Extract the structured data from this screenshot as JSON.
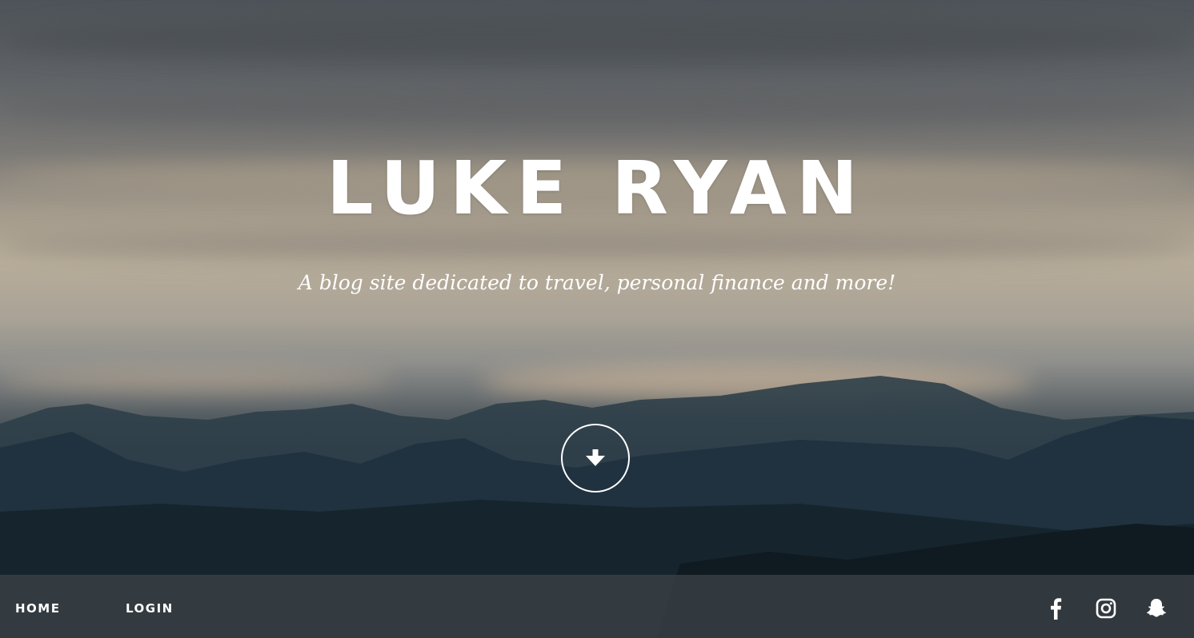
{
  "hero": {
    "title": "LUKE RYAN",
    "subtitle": "A blog site dedicated to travel, personal finance and more!",
    "scroll_icon": "arrow-down-circle-icon"
  },
  "navbar": {
    "links": [
      {
        "label": "HOME"
      },
      {
        "label": "LOGIN"
      }
    ],
    "social": [
      {
        "icon": "facebook-icon"
      },
      {
        "icon": "instagram-icon"
      },
      {
        "icon": "snapchat-icon"
      }
    ]
  },
  "colors": {
    "text": "#ffffff",
    "navbar_bg": "rgba(60, 65, 70, 0.78)"
  }
}
